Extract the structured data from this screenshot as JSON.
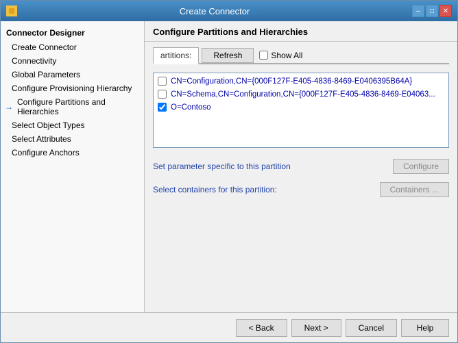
{
  "window": {
    "title": "Create Connector",
    "icon": "gear-icon"
  },
  "sidebar": {
    "header": "Connector Designer",
    "items": [
      {
        "id": "create-connector",
        "label": "Create Connector",
        "level": 1,
        "active": false,
        "arrow": false
      },
      {
        "id": "connectivity",
        "label": "Connectivity",
        "level": 2,
        "active": false,
        "arrow": false
      },
      {
        "id": "global-parameters",
        "label": "Global Parameters",
        "level": 2,
        "active": false,
        "arrow": false
      },
      {
        "id": "configure-provisioning-hierarchy",
        "label": "Configure Provisioning Hierarchy",
        "level": 2,
        "active": false,
        "arrow": false
      },
      {
        "id": "configure-partitions-and-hierarchies",
        "label": "Configure Partitions and Hierarchies",
        "level": 2,
        "active": true,
        "arrow": true
      },
      {
        "id": "select-object-types",
        "label": "Select Object Types",
        "level": 2,
        "active": false,
        "arrow": false
      },
      {
        "id": "select-attributes",
        "label": "Select Attributes",
        "level": 2,
        "active": false,
        "arrow": false
      },
      {
        "id": "configure-anchors",
        "label": "Configure Anchors",
        "level": 2,
        "active": false,
        "arrow": false
      }
    ]
  },
  "main": {
    "header": "Configure Partitions and Hierarchies",
    "tab_label": "artitions:",
    "refresh_btn": "Refresh",
    "show_all_label": "Show All",
    "partitions": [
      {
        "id": "p1",
        "checked": false,
        "label": "CN=Configuration,CN={000F127F-E405-4836-8469-E0406395B64A}"
      },
      {
        "id": "p2",
        "checked": false,
        "label": "CN=Schema,CN=Configuration,CN={000F127F-E405-4836-8469-E04063..."
      },
      {
        "id": "p3",
        "checked": true,
        "label": "O=Contoso"
      }
    ],
    "set_parameter_label": "Set parameter specific to this partition",
    "configure_btn": "Configure",
    "select_containers_label": "Select containers for this partition:",
    "containers_btn": "Containers ..."
  },
  "footer": {
    "back_btn": "< Back",
    "next_btn": "Next >",
    "cancel_btn": "Cancel",
    "help_btn": "Help"
  }
}
